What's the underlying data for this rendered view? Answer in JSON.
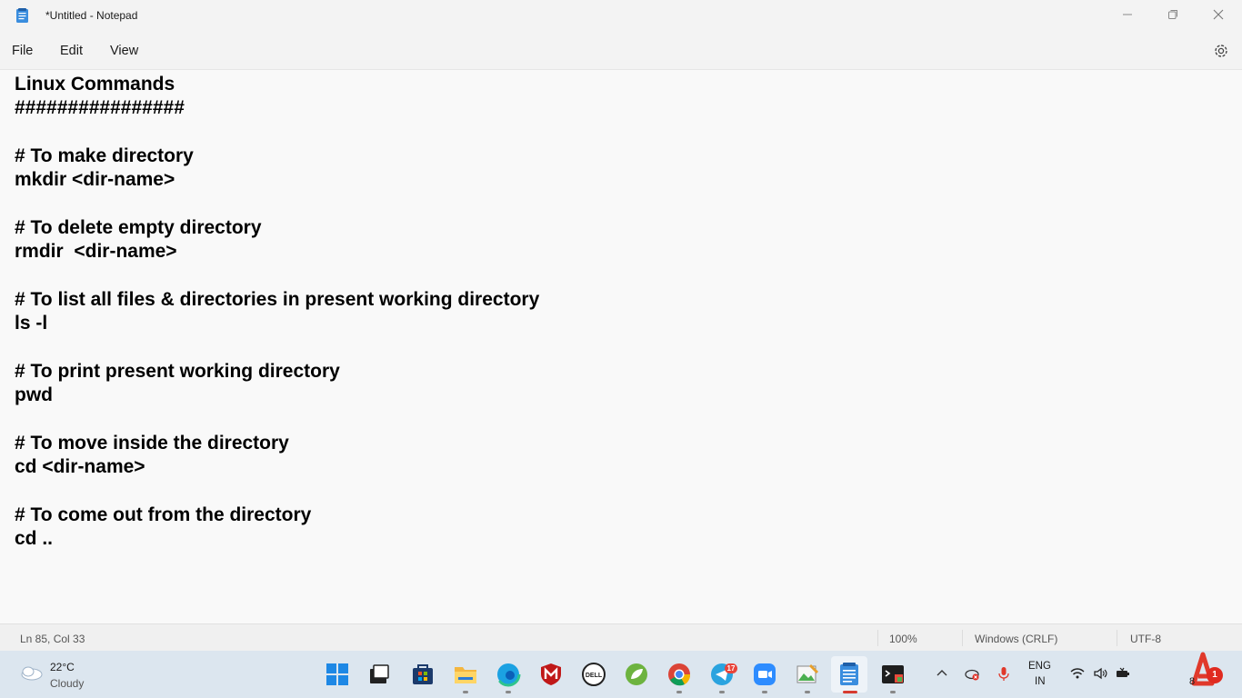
{
  "window": {
    "title": "*Untitled - Notepad",
    "app_icon": "notepad-icon",
    "controls": [
      "minimize-icon",
      "maximize-icon",
      "close-icon"
    ]
  },
  "menu": {
    "file": "File",
    "edit": "Edit",
    "view": "View",
    "settings_icon": "gear-icon"
  },
  "editor": {
    "lines": [
      "Linux Commands",
      "################",
      "",
      "# To make directory",
      "mkdir <dir-name>",
      "",
      "# To delete empty directory",
      "rmdir  <dir-name>",
      "",
      "# To list all files & directories in present working directory",
      "ls -l",
      "",
      "# To print present working directory",
      "pwd",
      "",
      "# To move inside the directory",
      "cd <dir-name>",
      "",
      "# To come out from the directory",
      "cd .."
    ]
  },
  "status": {
    "position": "Ln 85, Col 33",
    "zoom": "100%",
    "line_ending": "Windows (CRLF)",
    "encoding": "UTF-8"
  },
  "taskbar": {
    "weather": {
      "temp": "22°C",
      "desc": "Cloudy",
      "icon": "cloud-icon"
    },
    "apps": [
      "start-icon",
      "task-view-icon",
      "store-icon",
      "file-explorer-icon",
      "edge-icon",
      "mcafee-icon",
      "dell-icon",
      "spring-icon",
      "chrome-icon",
      "telegram-icon",
      "zoom-icon",
      "image-editor-icon",
      "notepad-icon",
      "terminal-icon"
    ],
    "telegram_badge": "17",
    "tray": {
      "chevron": "chevron-up-icon",
      "onedrive": "onedrive-icon",
      "mic": "microphone-icon",
      "lang_top": "ENG",
      "lang_bottom": "IN",
      "wifi": "wifi-icon",
      "volume": "volume-icon",
      "battery": "battery-icon",
      "clock_partial": "8",
      "notification_count": "1"
    }
  },
  "colors": {
    "taskbar_bg": "#dce6ef",
    "editor_bg": "#f9f9f9",
    "accent_red": "#d63a2f"
  }
}
